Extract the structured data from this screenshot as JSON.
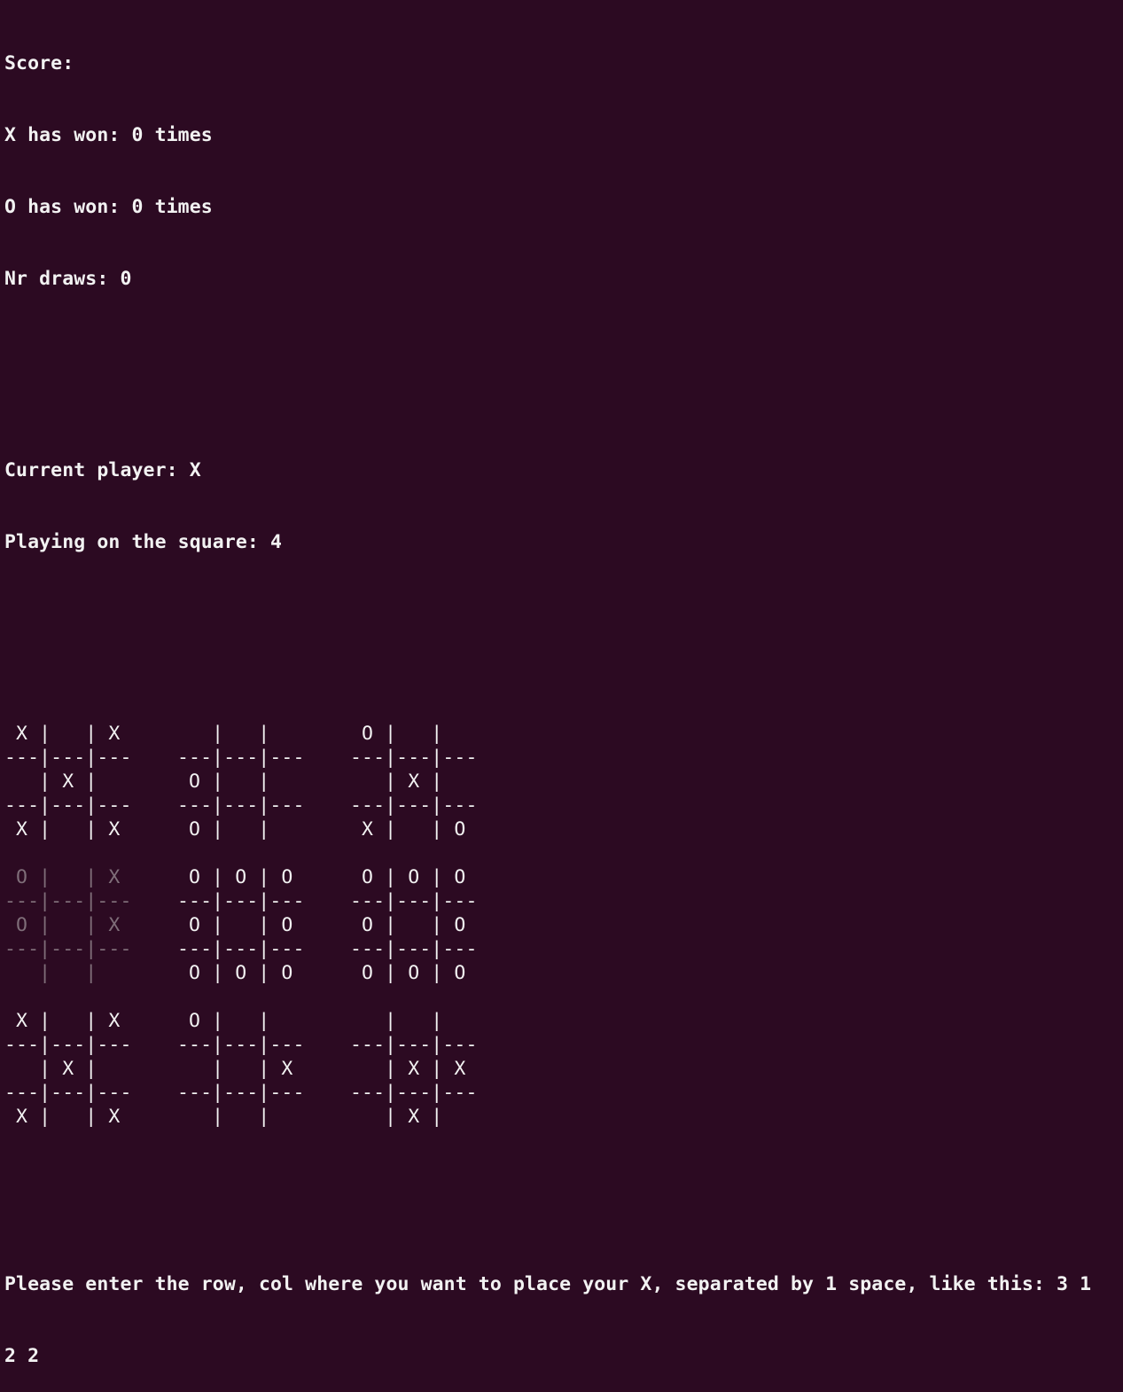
{
  "score": {
    "heading": "Score:",
    "x_won": "X has won: 0 times",
    "o_won": "O has won: 0 times",
    "draws": "Nr draws: 0"
  },
  "status": {
    "current_player": "Current player: X",
    "playing_square": "Playing on the square: 4"
  },
  "boards": [
    [
      {
        "lines": [
          " X |   | X",
          "---|---|---",
          "   | X |   ",
          "---|---|---",
          " X |   | X"
        ],
        "dim": false
      },
      {
        "lines": [
          "   |   |",
          "---|---|---",
          " O |   |",
          "---|---|---",
          " O |   |"
        ],
        "dim": false
      },
      {
        "lines": [
          " O |   |",
          "---|---|---",
          "   | X |",
          "---|---|---",
          " X |   | O"
        ],
        "dim": false
      }
    ],
    [
      {
        "lines": [
          " O |   | X",
          "---|---|---",
          " O |   | X",
          "---|---|---",
          "   |   |"
        ],
        "dim": true
      },
      {
        "lines": [
          " O | O | O",
          "---|---|---",
          " O |   | O",
          "---|---|---",
          " O | O | O"
        ],
        "dim": false
      },
      {
        "lines": [
          " O | O | O",
          "---|---|---",
          " O |   | O",
          "---|---|---",
          " O | O | O"
        ],
        "dim": false
      }
    ],
    [
      {
        "lines": [
          " X |   | X",
          "---|---|---",
          "   | X |",
          "---|---|---",
          " X |   | X"
        ],
        "dim": false
      },
      {
        "lines": [
          " O |   |",
          "---|---|---",
          "   |   | X",
          "---|---|---",
          "   |   |"
        ],
        "dim": false
      },
      {
        "lines": [
          "   |   |",
          "---|---|---",
          "   | X | X",
          "---|---|---",
          "   | X |"
        ],
        "dim": false
      }
    ]
  ],
  "prompt": {
    "text": "Please enter the row, col where you want to place your X, separated by 1 space, like this: 3 1",
    "input_value": "2 2"
  }
}
